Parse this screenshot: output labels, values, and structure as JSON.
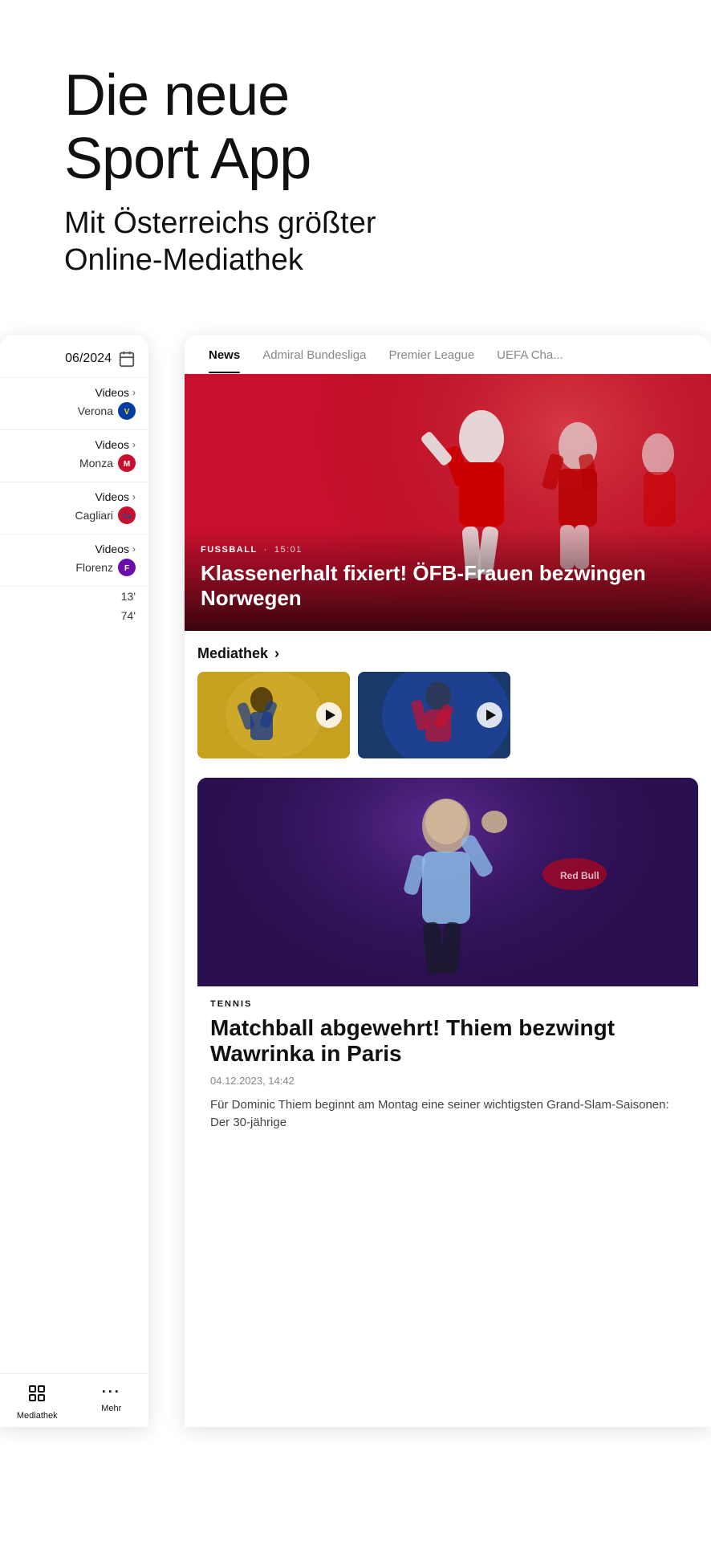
{
  "hero": {
    "title_line1": "Die neue",
    "title_line2": "Sport App",
    "subtitle_line1": "Mit Österreichs größter",
    "subtitle_line2": "Online-Mediathek"
  },
  "tabs": {
    "items": [
      {
        "id": "news",
        "label": "News",
        "active": true
      },
      {
        "id": "admiral",
        "label": "Admiral Bundesliga",
        "active": false
      },
      {
        "id": "premier",
        "label": "Premier League",
        "active": false
      },
      {
        "id": "uefa",
        "label": "UEFA Cha...",
        "active": false
      }
    ]
  },
  "main_news": {
    "category": "FUSSBALL",
    "time": "15:01",
    "title": "Klassenerhalt fixiert! ÖFB-Frauen bezwingen Norwegen"
  },
  "mediathek": {
    "label": "Mediathek",
    "chevron": "›"
  },
  "article": {
    "category": "TENNIS",
    "title": "Matchball abgewehrt! Thiem bezwingt Wawrinka in Paris",
    "date": "04.12.2023, 14:42",
    "excerpt": "Für Dominic Thiem beginnt am Montag eine seiner wichtigsten Grand-Slam-Saisonen: Der 30-jährige"
  },
  "left_panel": {
    "date": "06/2024",
    "calendar_icon": "📅",
    "matches": [
      {
        "videos": "Videos",
        "team": "Verona",
        "badge_class": "badge-verona",
        "badge_letter": "V"
      },
      {
        "videos": "Videos",
        "team": "Monza",
        "badge_class": "badge-monza",
        "badge_letter": "M"
      },
      {
        "videos": "Videos",
        "team": "Cagliari",
        "badge_class": "badge-cagliari",
        "badge_letter": "C"
      },
      {
        "videos": "Videos",
        "team": "Florenz",
        "badge_class": "badge-florenz",
        "badge_letter": "F"
      }
    ],
    "scores": [
      "13'",
      "74'"
    ],
    "nav": [
      {
        "label": "Mediathek",
        "icon": "⊞"
      },
      {
        "label": "Mehr",
        "icon": "···"
      }
    ]
  }
}
